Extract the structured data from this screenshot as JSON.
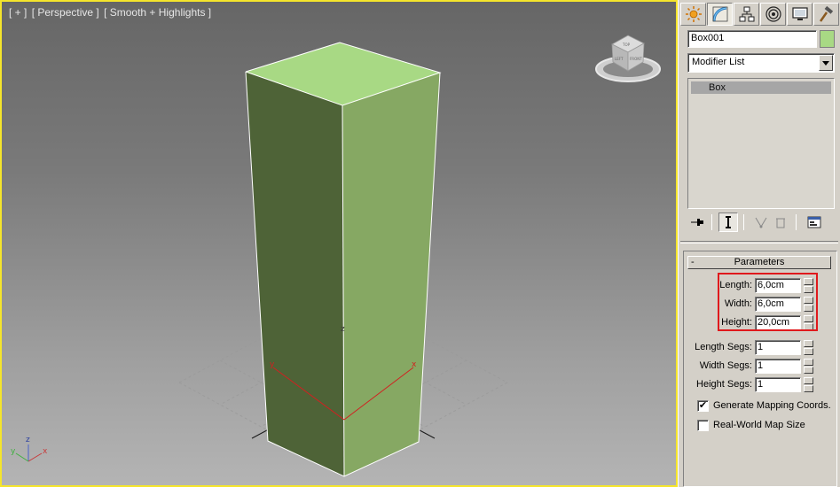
{
  "viewport": {
    "label_parts": [
      "[ + ]",
      "[ Perspective ]",
      "[ Smooth + Highlights ]"
    ],
    "object_color": "#a8d984",
    "active_border_color": "#f5e52b",
    "gizmo_axes": {
      "x": "x",
      "y": "y",
      "z": "z"
    },
    "viewcube_faces": {
      "top": "TOP",
      "front": "FRONT",
      "left": "LEFT"
    }
  },
  "command_panel": {
    "tabs": [
      {
        "name": "create-tab",
        "icon": "sun-star-icon"
      },
      {
        "name": "modify-tab",
        "icon": "modify-bend-icon",
        "active": true
      },
      {
        "name": "hierarchy-tab",
        "icon": "hierarchy-icon"
      },
      {
        "name": "motion-tab",
        "icon": "motion-circle-icon"
      },
      {
        "name": "display-tab",
        "icon": "display-monitor-icon"
      },
      {
        "name": "utilities-tab",
        "icon": "hammer-icon"
      }
    ],
    "object_name": "Box001",
    "object_color": "#a8d984",
    "modifier_list": "Modifier List",
    "stack_items": [
      "Box"
    ],
    "parameters": {
      "title": "Parameters",
      "collapse_symbol": "-",
      "length_label": "Length:",
      "length_value": "6,0cm",
      "width_label": "Width:",
      "width_value": "6,0cm",
      "height_label": "Height:",
      "height_value": "20,0cm",
      "length_segs_label": "Length Segs:",
      "length_segs_value": "1",
      "width_segs_label": "Width Segs:",
      "width_segs_value": "1",
      "height_segs_label": "Height Segs:",
      "height_segs_value": "1",
      "gen_mapping_label": "Generate Mapping Coords.",
      "gen_mapping_checked": true,
      "real_world_label": "Real-World Map Size",
      "real_world_checked": false
    },
    "highlight_color": "#e0191c"
  }
}
